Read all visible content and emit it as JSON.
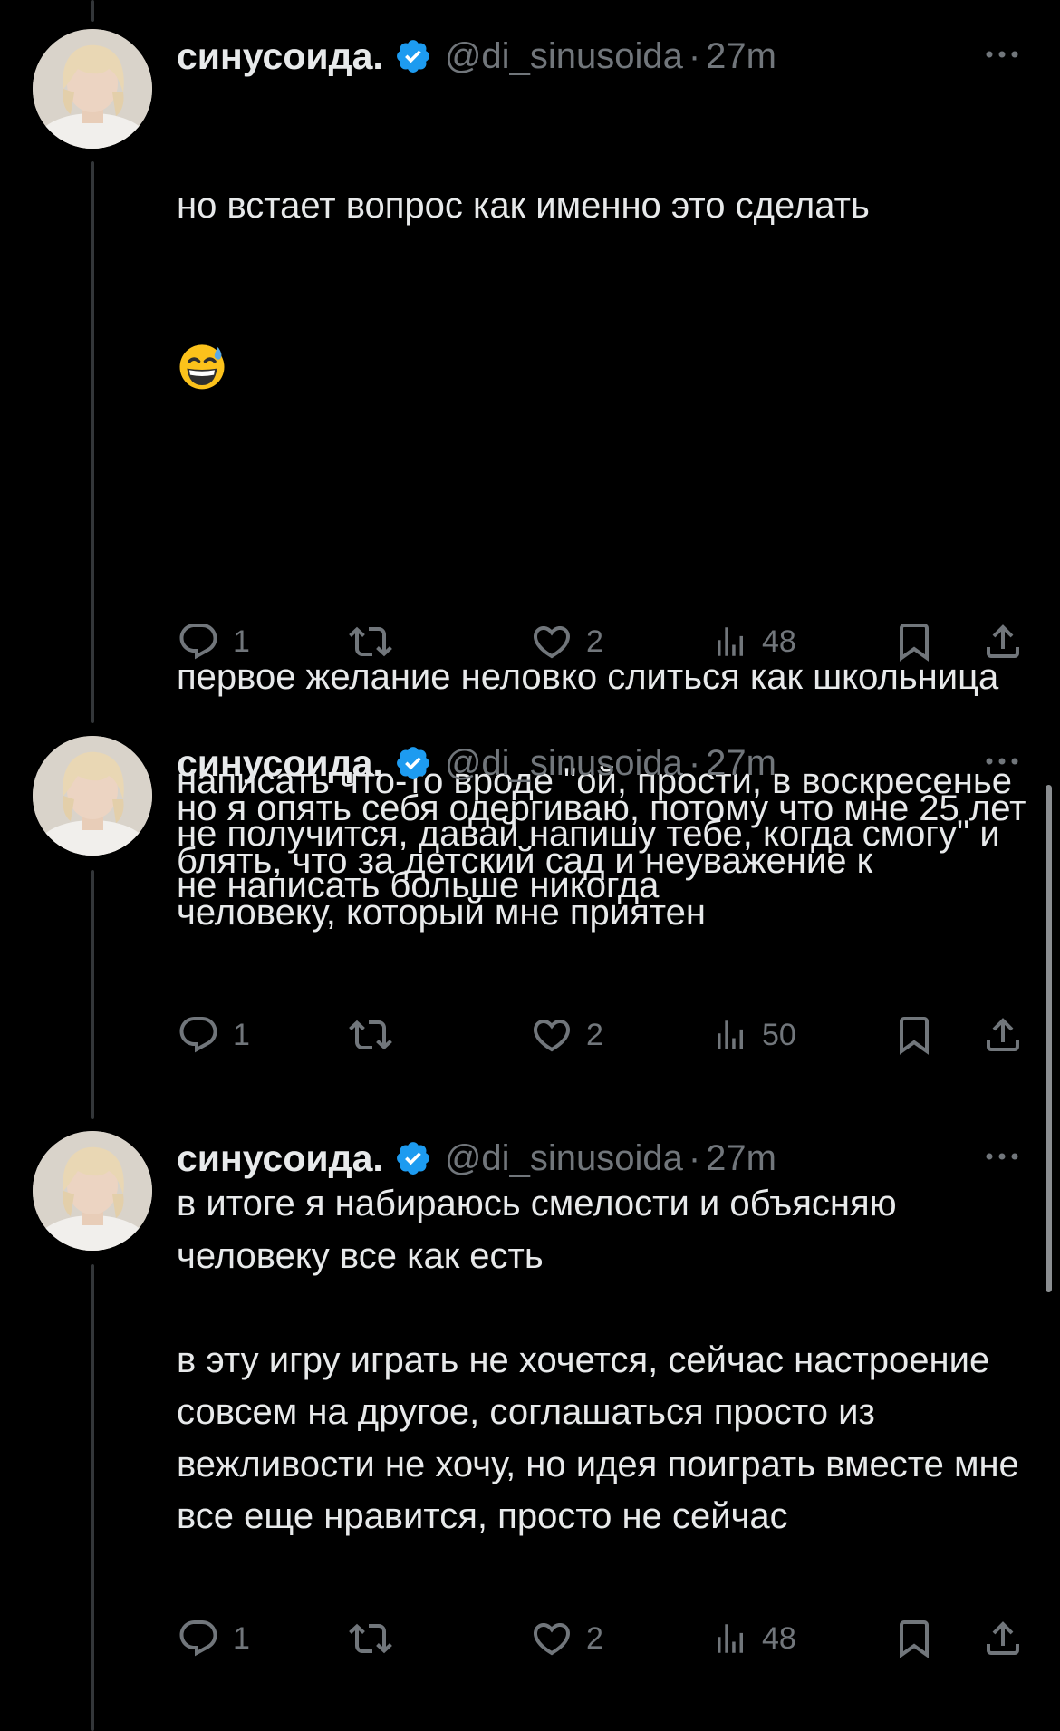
{
  "colors": {
    "background": "#000000",
    "text": "#e7e9ea",
    "muted": "#71767b",
    "verified": "#1d9bf0",
    "thread_line": "#333639"
  },
  "tweets": [
    {
      "name": "синусоида.",
      "handle": "@di_sinusoida",
      "separator": "·",
      "time": "27m",
      "text_before_emoji": "но встает вопрос как именно это сделать",
      "emoji": "grinning-face-with-sweat-icon",
      "text_after_emoji": "первое желание неловко слиться как школьница\n\nнаписать что-то вроде \"ой, прости, в воскресенье не получится, давай напишу тебе, когда смогу\" и не написать больше никогда",
      "replies": "1",
      "likes": "2",
      "views": "48"
    },
    {
      "name": "синусоида.",
      "handle": "@di_sinusoida",
      "separator": "·",
      "time": "27m",
      "text": "но я опять себя одергиваю, потому что мне 25 лет блять, что за детский сад и неуважение к человеку, который мне приятен",
      "replies": "1",
      "likes": "2",
      "views": "50"
    },
    {
      "name": "синусоида.",
      "handle": "@di_sinusoida",
      "separator": "·",
      "time": "27m",
      "text": "в итоге я набираюсь смелости и объясняю человеку все как есть\n\nв эту игру играть не хочется, сейчас настроение совсем на другое, соглашаться просто из вежливости не хочу, но идея поиграть вместе мне все еще нравится, просто не сейчас",
      "replies": "1",
      "likes": "2",
      "views": "48"
    }
  ]
}
